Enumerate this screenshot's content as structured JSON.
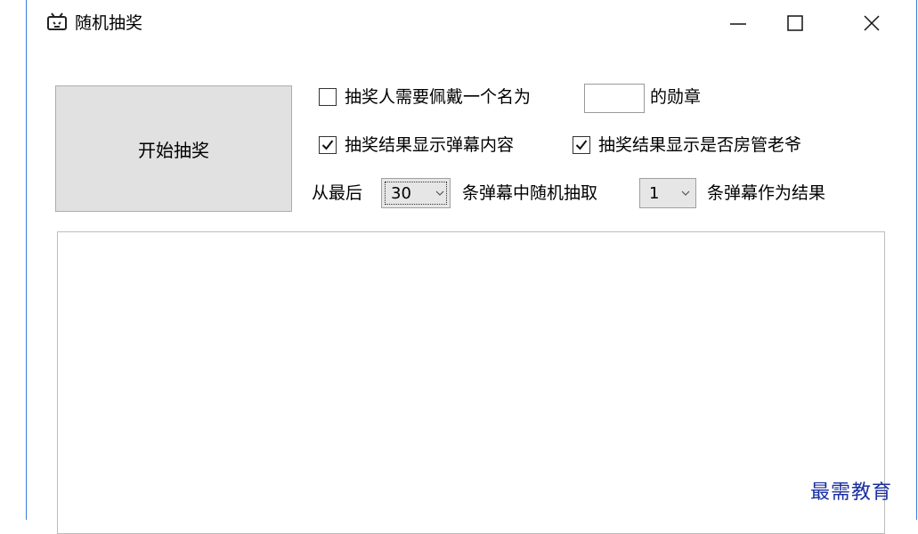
{
  "window": {
    "title": "随机抽奖",
    "icons": {
      "app": "tv-icon",
      "minimize": "minimize-icon",
      "maximize": "maximize-icon",
      "close": "close-icon"
    }
  },
  "start_button": {
    "label": "开始抽奖"
  },
  "badge_option": {
    "checked": false,
    "label_before": "抽奖人需要佩戴一个名为",
    "badge_name_value": "",
    "label_after": "的勋章"
  },
  "show_danmaku_option": {
    "checked": true,
    "label": "抽奖结果显示弹幕内容"
  },
  "show_admin_option": {
    "checked": true,
    "label": "抽奖结果显示是否房管老爷"
  },
  "range_row": {
    "prefix": "从最后",
    "count_value": "30",
    "middle": "条弹幕中随机抽取",
    "pick_value": "1",
    "suffix": "条弹幕作为结果"
  },
  "result_box": {
    "text": ""
  },
  "watermark": "最需教育"
}
